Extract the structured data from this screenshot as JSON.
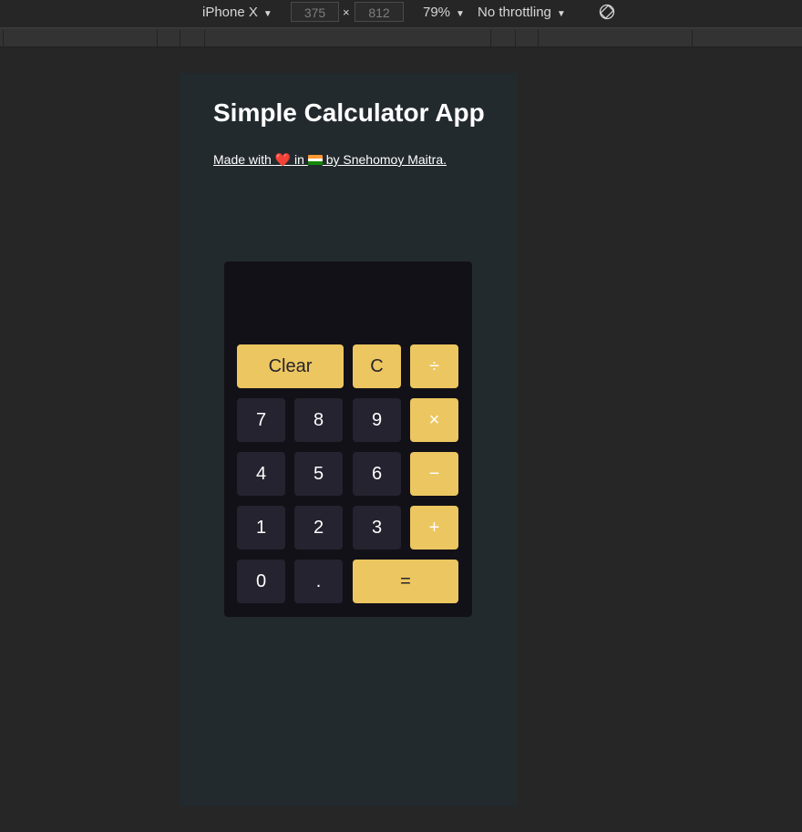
{
  "toolbar": {
    "device": "iPhone X",
    "width": "375",
    "times": "×",
    "height": "812",
    "zoom": "79%",
    "throttling": "No throttling",
    "rotate_icon": "rotate-device-icon"
  },
  "app": {
    "title": "Simple Calculator App",
    "credit_prefix": "Made with ",
    "credit_heart": "❤️",
    "credit_in": " in ",
    "credit_suffix": " by Snehomoy Maitra.",
    "flag_icon": "india-flag-icon",
    "colors": {
      "background": "#232a2e",
      "calculator": "#121117",
      "number_key": "#25232f",
      "accent_key": "#ecc660"
    }
  },
  "calculator": {
    "display": "",
    "keys": {
      "clear": "Clear",
      "delete": "C",
      "divide": "÷",
      "seven": "7",
      "eight": "8",
      "nine": "9",
      "multiply": "×",
      "four": "4",
      "five": "5",
      "six": "6",
      "subtract": "−",
      "one": "1",
      "two": "2",
      "three": "3",
      "add": "+",
      "zero": "0",
      "decimal": ".",
      "equals": "="
    }
  }
}
